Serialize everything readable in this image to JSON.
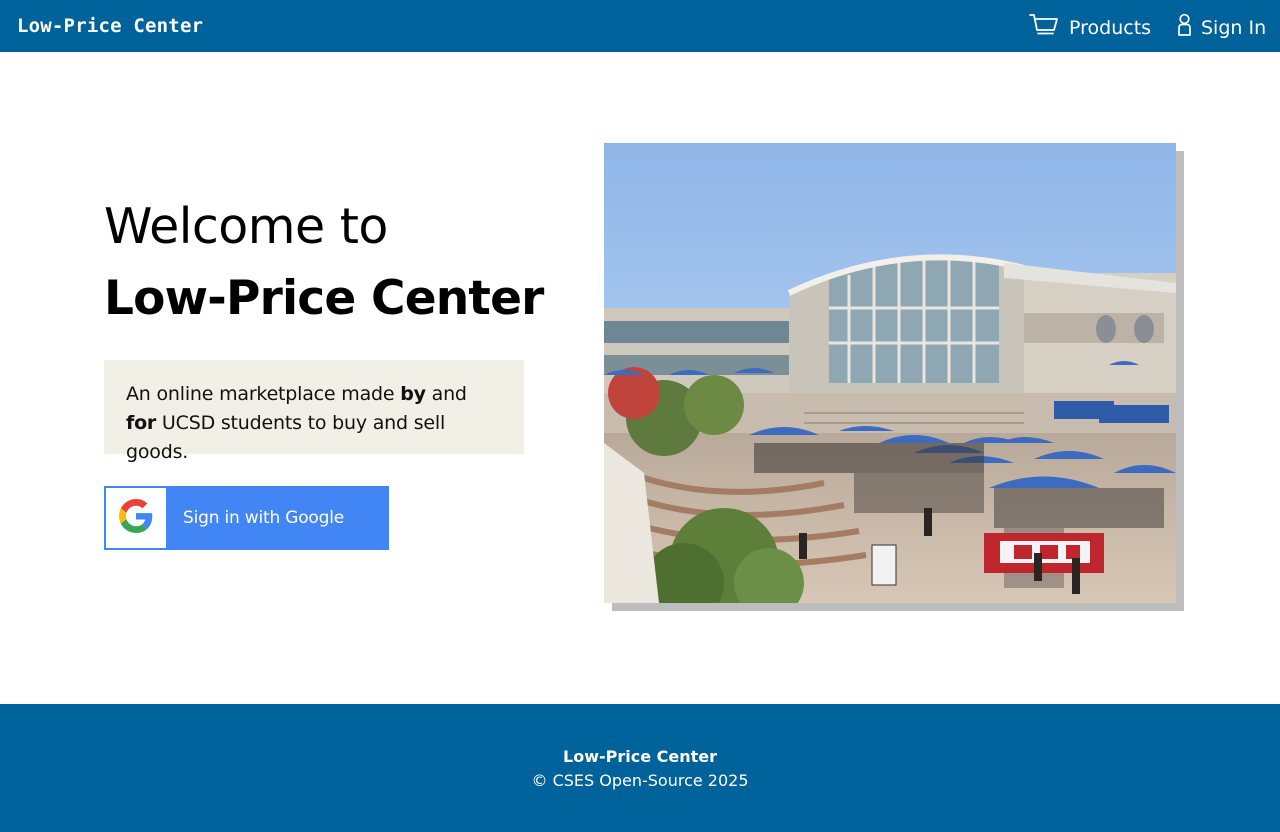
{
  "navbar": {
    "brand": "Low-Price Center",
    "products_label": "Products",
    "signin_label": "Sign In",
    "background_color": "#00629b"
  },
  "hero": {
    "welcome_line": "Welcome to",
    "title": "Low-Price Center",
    "tagline": {
      "part1": "An online marketplace made ",
      "bold1": "by",
      "part2": " and ",
      "bold2": "for",
      "part3": " UCSD students to buy and sell goods."
    },
    "google_button_label": "Sign in with Google",
    "google_button_color": "#4285f4",
    "photo_icon": "campus-plaza-photo"
  },
  "footer": {
    "title": "Low-Price Center",
    "copyright": "© CSES Open-Source 2025"
  }
}
